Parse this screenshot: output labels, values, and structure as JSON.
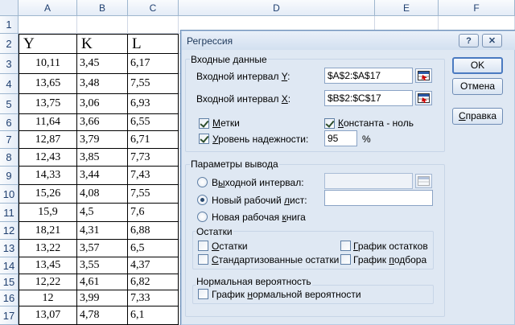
{
  "sheet": {
    "columns": [
      "A",
      "B",
      "C",
      "D",
      "E",
      "F"
    ],
    "rows": [
      "1",
      "2",
      "3",
      "4",
      "5",
      "6",
      "7",
      "8",
      "9",
      "10",
      "11",
      "12",
      "13",
      "14",
      "15",
      "16",
      "17"
    ],
    "headers": {
      "y": "Y",
      "k": "K",
      "l": "L"
    },
    "data": [
      [
        "10,11",
        "3,45",
        "6,17"
      ],
      [
        "13,65",
        "3,48",
        "7,55"
      ],
      [
        "13,75",
        "3,06",
        "6,93"
      ],
      [
        "11,64",
        "3,66",
        "6,55"
      ],
      [
        "12,87",
        "3,79",
        "6,71"
      ],
      [
        "12,43",
        "3,85",
        "7,73"
      ],
      [
        "14,33",
        "3,44",
        "7,43"
      ],
      [
        "15,26",
        "4,08",
        "7,55"
      ],
      [
        "15,9",
        "4,5",
        "7,6"
      ],
      [
        "18,21",
        "4,31",
        "6,88"
      ],
      [
        "13,22",
        "3,57",
        "6,5"
      ],
      [
        "13,45",
        "3,55",
        "4,37"
      ],
      [
        "12,22",
        "4,61",
        "6,82"
      ],
      [
        "12",
        "3,99",
        "7,33"
      ],
      [
        "13,07",
        "4,78",
        "6,1"
      ]
    ]
  },
  "dialog": {
    "title": "Регрессия",
    "help_glyph": "?",
    "close_glyph": "✕",
    "input_group": {
      "label": "Входные данные",
      "y_label_pre": "Входной интервал ",
      "y_label_key": "Y",
      "y_label_post": ":",
      "y_value": "$A$2:$A$17",
      "x_label_pre": "Входной интервал ",
      "x_label_key": "X",
      "x_label_post": ":",
      "x_value": "$B$2:$C$17",
      "labels_key": "М",
      "labels_rest": "етки",
      "labels_checked": true,
      "constant_key": "К",
      "constant_rest": "онстанта - ноль",
      "constant_checked": true,
      "confidence_key": "У",
      "confidence_rest": "ровень надежности:",
      "confidence_checked": true,
      "confidence_value": "95",
      "confidence_unit": "%"
    },
    "output_group": {
      "label": "Параметры вывода",
      "output_range_pre": "В",
      "output_range_key": "ы",
      "output_range_post": "ходной интервал:",
      "new_sheet_pre": "Новый рабочий ",
      "new_sheet_key": "л",
      "new_sheet_post": "ист:",
      "new_sheet_selected": true,
      "new_book_pre": "Новая рабочая ",
      "new_book_key": "к",
      "new_book_post": "нига"
    },
    "residuals_group": {
      "label": "Остатки",
      "residuals_pre": "",
      "residuals_key": "О",
      "residuals_post": "статки",
      "std_residuals_pre": "",
      "std_residuals_key": "С",
      "std_residuals_post": "тандартизованные остатки",
      "residual_plot_pre": "",
      "residual_plot_key": "Г",
      "residual_plot_post": "рафик остатков",
      "fit_plot_pre": "График ",
      "fit_plot_key": "п",
      "fit_plot_post": "одбора"
    },
    "normal_group": {
      "label": "Нормальная вероятность",
      "normal_plot_pre": "График ",
      "normal_plot_key": "н",
      "normal_plot_post": "ормальной вероятности"
    },
    "buttons": {
      "ok": "OK",
      "cancel": "Отмена",
      "help_key": "С",
      "help_rest": "правка"
    }
  }
}
